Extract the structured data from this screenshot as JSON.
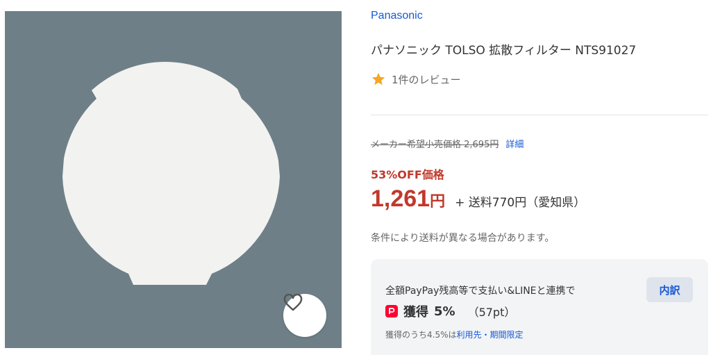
{
  "product": {
    "brand": "Panasonic",
    "title": "パナソニック TOLSO 拡散フィルター NTS91027",
    "review_text": "1件のレビュー"
  },
  "price": {
    "list_label": "メーカー希望小売価格 2,695円",
    "detail_link": "詳細",
    "discount_label": "53%OFF価格",
    "amount": "1,261",
    "currency": "円",
    "shipping": "+ 送料770円（愛知県）",
    "shipping_note": "条件により送料が異なる場合があります。"
  },
  "paypay": {
    "text": "全額PayPay残高等で支払い&LINEと連携で",
    "breakdown_label": "内訳",
    "earn_label": "獲得",
    "earn_percent": "5%",
    "earn_points": "（57pt）",
    "note_prefix": "獲得のうち4.5%は",
    "note_link": "利用先・期間限定"
  },
  "colors": {
    "price_red": "#c0392b",
    "link_blue": "#1558d6",
    "image_bg": "#6e7f87",
    "star": "#f5a623",
    "paypay_red": "#ff0033"
  },
  "icons": [
    "heart-icon",
    "star-icon",
    "paypay-icon"
  ]
}
